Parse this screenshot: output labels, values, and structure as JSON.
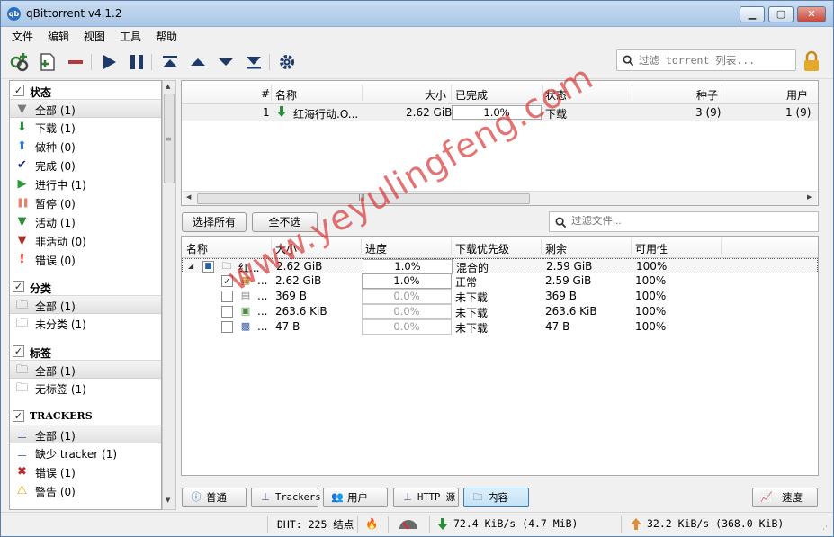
{
  "window": {
    "title": "qBittorrent v4.1.2",
    "app_icon": "qb"
  },
  "menu": [
    "文件",
    "编辑",
    "视图",
    "工具",
    "帮助"
  ],
  "search": {
    "placeholder": "过滤 torrent 列表..."
  },
  "file_search": {
    "placeholder": "过滤文件..."
  },
  "sidebar": {
    "status": {
      "title": "状态",
      "checked": true,
      "items": [
        {
          "label": "全部 (1)",
          "icon": "funnel-icon",
          "color": "#7a7a7a",
          "selected": true
        },
        {
          "label": "下载 (1)",
          "icon": "down-arrow-icon",
          "color": "#2e8b3a"
        },
        {
          "label": "做种 (0)",
          "icon": "up-arrow-icon",
          "color": "#2f6fcf"
        },
        {
          "label": "完成 (0)",
          "icon": "checkmark-icon",
          "color": "#1c2a7a"
        },
        {
          "label": "进行中 (1)",
          "icon": "play-icon",
          "color": "#2e9b3a"
        },
        {
          "label": "暂停 (0)",
          "icon": "pause-icon",
          "color": "#e8806a"
        },
        {
          "label": "活动 (1)",
          "icon": "funnel-icon",
          "color": "#2e8b3a"
        },
        {
          "label": "非活动 (0)",
          "icon": "funnel-icon",
          "color": "#a3322a"
        },
        {
          "label": "错误 (0)",
          "icon": "exclamation-icon",
          "color": "#e01010"
        }
      ]
    },
    "category": {
      "title": "分类",
      "checked": true,
      "items": [
        {
          "label": "全部 (1)",
          "icon": "folder-icon",
          "selected": true
        },
        {
          "label": "未分类 (1)",
          "icon": "folder-icon"
        }
      ]
    },
    "tags": {
      "title": "标签",
      "checked": true,
      "items": [
        {
          "label": "全部 (1)",
          "icon": "folder-icon",
          "selected": true
        },
        {
          "label": "无标签 (1)",
          "icon": "folder-icon"
        }
      ]
    },
    "trackers": {
      "title": "TRACKERS",
      "checked": true,
      "items": [
        {
          "label": "全部 (1)",
          "icon": "tracker-icon",
          "selected": true
        },
        {
          "label": "缺少 tracker (1)",
          "icon": "tracker-icon"
        },
        {
          "label": "错误 (1)",
          "icon": "error-x-icon"
        },
        {
          "label": "警告 (0)",
          "icon": "warning-icon"
        }
      ]
    }
  },
  "torrent_table": {
    "headers": {
      "num": "#",
      "name": "名称",
      "size": "大小",
      "done": "已完成",
      "status": "状态",
      "seeds": "种子",
      "peers": "用户"
    },
    "rows": [
      {
        "num": "1",
        "name": "红海行动.O...",
        "size": "2.62 GiB",
        "done": "1.0%",
        "progress": 0.01,
        "status": "下载",
        "seeds": "3 (9)",
        "peers": "1 (9)"
      }
    ]
  },
  "buttons": {
    "select_all": "选择所有",
    "select_none": "全不选"
  },
  "file_table": {
    "headers": {
      "name": "名称",
      "size": "大小",
      "progress": "进度",
      "priority": "下载优先级",
      "remaining": "剩余",
      "availability": "可用性"
    },
    "rows": [
      {
        "name": "红...",
        "size": "2.62 GiB",
        "progress": "1.0%",
        "priority": "混合的",
        "remaining": "2.59 GiB",
        "availability": "100%",
        "check": "partial",
        "icon": "folder-icon",
        "level": 0
      },
      {
        "name": "...",
        "size": "2.62 GiB",
        "progress": "1.0%",
        "priority": "正常",
        "remaining": "2.59 GiB",
        "availability": "100%",
        "check": "checked",
        "icon": "video-file-icon",
        "level": 1
      },
      {
        "name": "...",
        "size": "369 B",
        "progress": "0.0%",
        "priority": "未下载",
        "remaining": "369 B",
        "availability": "100%",
        "check": "unchecked",
        "icon": "text-file-icon",
        "level": 1
      },
      {
        "name": "...",
        "size": "263.6 KiB",
        "progress": "0.0%",
        "priority": "未下载",
        "remaining": "263.6 KiB",
        "availability": "100%",
        "check": "unchecked",
        "icon": "image-file-icon",
        "level": 1
      },
      {
        "name": "...",
        "size": "47 B",
        "progress": "0.0%",
        "priority": "未下载",
        "remaining": "47 B",
        "availability": "100%",
        "check": "unchecked",
        "icon": "link-file-icon",
        "level": 1
      }
    ]
  },
  "tabs": [
    {
      "label": "普通",
      "icon": "info-icon"
    },
    {
      "label": "Trackers",
      "icon": "tracker-icon"
    },
    {
      "label": "用户",
      "icon": "users-icon"
    },
    {
      "label": "HTTP 源",
      "icon": "http-icon"
    },
    {
      "label": "内容",
      "icon": "folder-icon",
      "active": true
    }
  ],
  "speed_button": "速度",
  "statusbar": {
    "dht": "DHT: 225 结点",
    "download": "72.4  KiB/s (4.7  MiB)",
    "upload": "32.2  KiB/s (368.0  KiB)"
  },
  "watermark": "www.yeyulingfeng.com"
}
